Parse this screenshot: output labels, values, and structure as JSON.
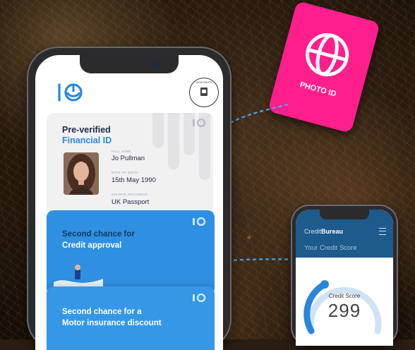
{
  "main_phone": {
    "badge": {
      "top_text": "DATA RIGHTS",
      "icon": "shield-icon"
    },
    "card1": {
      "title_line1": "Pre-verified",
      "title_line2": "Financial ID",
      "fields": [
        {
          "label": "FULL NAME",
          "value": "Jo Pullman"
        },
        {
          "label": "DATE OF BIRTH",
          "value": "15th May 1990"
        },
        {
          "label": "SOURCE DOCUMENT",
          "value": "UK Passport"
        }
      ]
    },
    "card2": {
      "title_line1": "Second chance for",
      "title_line2": "Credit approval"
    },
    "card3": {
      "title_line1": "Second chance for a",
      "title_line2": "Motor insurance discount"
    }
  },
  "photo_id": {
    "label": "PHOTO ID",
    "icon": "globe-icon",
    "color": "#ff1f8c"
  },
  "credit_phone": {
    "brand_light": "Credit",
    "brand_bold": "Bureau",
    "subtitle": "Your Credit Score",
    "score_label": "Credit Score",
    "score_value": "299",
    "gauge_fraction": 0.35
  },
  "colors": {
    "brand_blue": "#2a86db",
    "card_blue": "#2f8fe0",
    "navy": "#1f2a44",
    "credit_header": "#1e5a8c"
  }
}
